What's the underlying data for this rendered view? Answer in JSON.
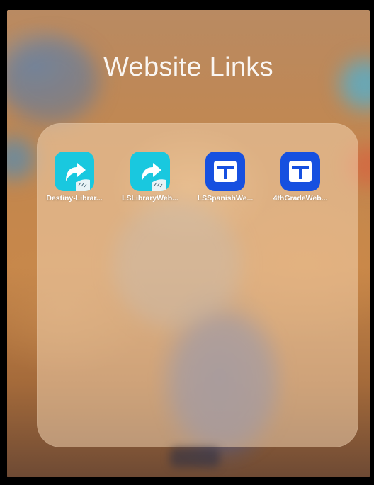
{
  "folder": {
    "title": "Website Links"
  },
  "apps": [
    {
      "label": "Destiny-Librar...",
      "icon": "share-arrow-icon",
      "color": "#19c8df"
    },
    {
      "label": "LSLibraryWeb...",
      "icon": "share-arrow-icon",
      "color": "#19c8df"
    },
    {
      "label": "LSSpanishWe...",
      "icon": "layout-template-icon",
      "color": "#1650e0"
    },
    {
      "label": "4thGradeWeb...",
      "icon": "layout-template-icon",
      "color": "#1650e0"
    }
  ]
}
